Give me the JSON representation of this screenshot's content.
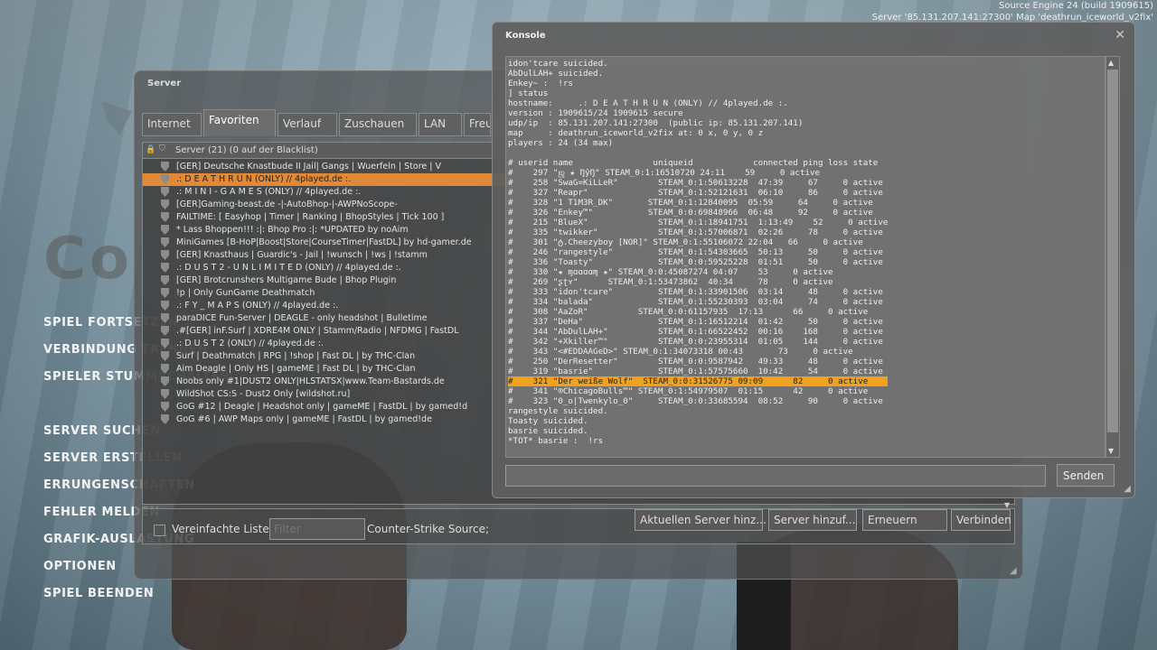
{
  "engine": {
    "line1": "Source Engine 24 (build 1909615)",
    "line2": "Server '85.131.207.141:27300' Map 'deathrun_iceworld_v2fix'"
  },
  "main_menu": [
    "SPIEL FORTSETZEN",
    "VERBINDUNG TRENNEN",
    "SPIELER STUMMSCHALTEN",
    "SERVER SUCHEN",
    "SERVER ERSTELLEN",
    "ERRUNGENSCHAFTEN",
    "FEHLER MELDEN",
    "GRAFIK-AUSLASTUNG",
    "OPTIONEN",
    "SPIEL BEENDEN"
  ],
  "server_window": {
    "title": "Server",
    "tabs": [
      "Internet",
      "Favoriten",
      "Verlauf",
      "Zuschauen",
      "LAN",
      "Freunde"
    ],
    "active_tab": "Favoriten",
    "list_header": "Server (21) (0 auf der Blacklist)",
    "servers": [
      "[GER] Deutsche Knastbude II Jail| Gangs | Wuerfeln | Store | V",
      ".: D E A T H R U N (ONLY) // 4played.de :.",
      ".: M I N I - G A M E S (ONLY) // 4played.de :.",
      "[GER]Gaming-beast.de -|-AutoBhop-|-AWPNoScope-",
      "FAILTIME: [ Easyhop | Timer | Ranking | BhopStyles | Tick 100 ]",
      "* Lass Bhoppen!!! :|: Bhop Pro :|: *UPDATED by noAim",
      "MiniGames [B-HoP|Boost|Store|CourseTimer|FastDL] by hd-gamer.de",
      "[GER] Knasthaus | Guardic's - Jail | !wunsch | !ws | !stamm",
      ".: D U S T 2 - U N L I M I T E D (ONLY) // 4played.de :.",
      "[GER] Brotcrunshers Multigame Bude | Bhop Plugin",
      "!p | Only GunGame Deathmatch",
      ".: F Y _ M A P S (ONLY) // 4played.de :.",
      "paraDICE Fun-Server | DEAGLE - only headshot | Bulletime",
      ".#[GER] inF.Surf | XDRE4M ONLY | Stamm/Radio | NFDMG | FastDL",
      ".: D U S T 2 (ONLY) // 4played.de :.",
      "Surf | Deathmatch | RPG | !shop | Fast DL | by THC-Clan",
      "Aim Deagle | Only HS | gameME | Fast DL | by THC-Clan",
      "Noobs only #1|DUST2 ONLY|HLSTATSX|www.Team-Bastards.de",
      "WildShot CS:S - Dust2 Only [wildshot.ru]",
      "GoG #12 | Deagle | Headshot only | gameME | FastDL | by gamed!d",
      "GoG #6 | AWP Maps only | gameME | FastDL | by gamed!de"
    ],
    "selected_index": 1,
    "checkbox_label": "Vereinfachte Liste",
    "filter_placeholder": "Filter",
    "game_label": "Counter-Strike Source;",
    "buttons": {
      "add_current": "Aktuellen Server hinz...",
      "add_server": "Server hinzuf...",
      "refresh": "Erneuern",
      "connect": "Verbinden"
    }
  },
  "console": {
    "title": "Konsole",
    "close_glyph": "✕",
    "lines": [
      "idon'tcare suicided.",
      "AbDulLAH+ suicided.",
      "Enkey~ :  !rs",
      "] status",
      "hostname:     .: D E A T H R U N (ONLY) // 4played.de :.",
      "version : 1909615/24 1909615 secure",
      "udp/ip  : 85.131.207.141:27300  (public ip: 85.131.207.141)",
      "map     : deathrun_iceworld_v2fix at: 0 x, 0 y, 0 z",
      "players : 24 (34 max)",
      "",
      "# userid name                uniqueid            connected ping loss state",
      "#    297 \"ஜ ★ ŊŷŊ\" STEAM_0:1:16510720 24:11    59     0 active",
      "#    258 \"SwaG=KiLLeR\"        STEAM_0:1:50613228  47:39     67     0 active",
      "#    327 \"Reapr\"              STEAM_0:1:52121631  06:10     86     0 active",
      "#    328 \"1 T1M3R_DK\"       STEAM_0:1:12840095  05:59     64     0 active",
      "#    326 \"Enkey™\"           STEAM_0:0:69848966  06:48     92     0 active",
      "#    215 \"BlueX\"              STEAM_0:1:18941751  1:13:49    52     0 active",
      "#    335 \"twikker\"            STEAM_0:1:57006871  02:26     78     0 active",
      "#    301 \"ტ.Cheezyboy [NOR]\" STEAM_0:1:55106072 22:04   66     0 active",
      "#    246 \"rangestyle\"         STEAM_0:1:54303665  50:13     50     0 active",
      "#    336 \"Toasty\"             STEAM_0:0:59525228  01:51     50     0 active",
      "#    330 \"★ ɱɑɑɑɑɱ ★\" STEAM_0:0:45087274 04:07    53     0 active",
      "#    269 \"ʂʈʏ\"      STEAM_0:1:53473862  40:34     78     0 active",
      "#    333 \"idon'tcare\"         STEAM_0:1:33901506  03:14     48     0 active",
      "#    334 \"balada\"             STEAM_0:1:55230393  03:04     74     0 active",
      "#    308 \"AaZoR\"          STEAM_0:0:61157935  17:13      66     0 active",
      "#    337 \"DeHa\"               STEAM_0:1:16512214  01:42     50     0 active",
      "#    344 \"AbDulLAH+\"          STEAM_0:1:66522452  00:16    168     0 active",
      "#    342 \"+Xkiller™\"          STEAM_0:0:23955314  01:05    144     0 active",
      "#    343 \"<#EDDAAGeD>\" STEAM_0:1:34073318 00:43       73     0 active",
      "#    250 \"DerResetter\"        STEAM_0:0:9587942   49:33     48     0 active",
      "#    319 \"basrie\"             STEAM_0:1:57575660  10:42     54     0 active",
      "#    321 \"Der weiße Wolf\"  STEAM_0:0:31526775 09:09      82     0 active",
      "#    341 \"®ChicagoBulls™\" STEAM_0:1:54979507  01:15      42     0 active",
      "#    323 \"0_o|Twenkylo_0\"     STEAM_0:0:33685594  08:52     90     0 active",
      "rangestyle suicided.",
      "Toasty suicided.",
      "basrie suicided.",
      "*TOT* basrie :  !rs"
    ],
    "highlight_index": 32,
    "send_label": "Senden"
  },
  "icons": {
    "lock": "lock-icon",
    "shield": "shield-icon",
    "scroll_up": "▲",
    "scroll_down": "▼",
    "grip": "◢"
  }
}
